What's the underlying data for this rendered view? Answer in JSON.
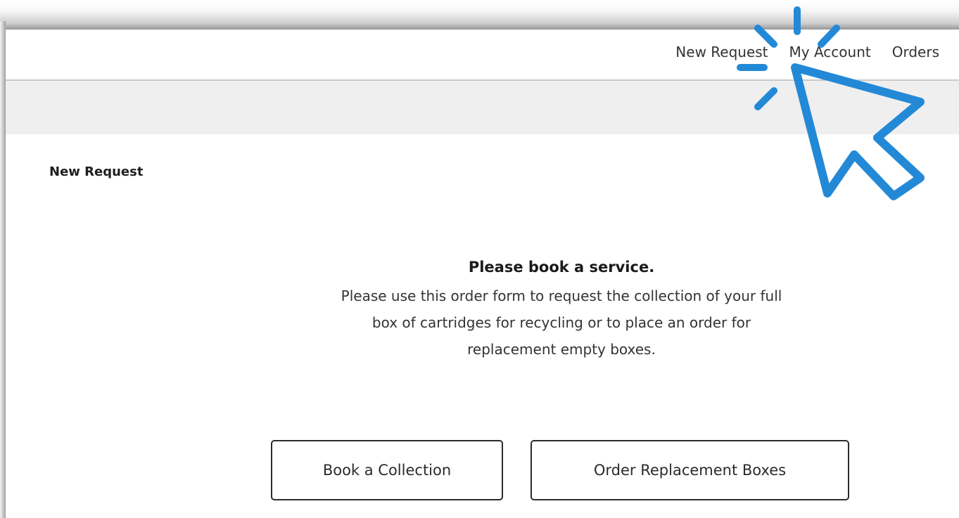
{
  "nav": {
    "items": [
      {
        "label": "New Request"
      },
      {
        "label": "My Account"
      },
      {
        "label": "Orders"
      }
    ]
  },
  "page": {
    "title": "New Request"
  },
  "intro": {
    "heading": "Please book a service.",
    "body": "Please use this order form to request the collection of your full box of cartridges for recycling or to place an order for replacement empty boxes."
  },
  "actions": {
    "book_collection_label": "Book a Collection",
    "order_replacement_label": "Order Replacement Boxes"
  },
  "overlay": {
    "cursor_icon": "click-pointer-icon",
    "color": "#2389d7"
  }
}
